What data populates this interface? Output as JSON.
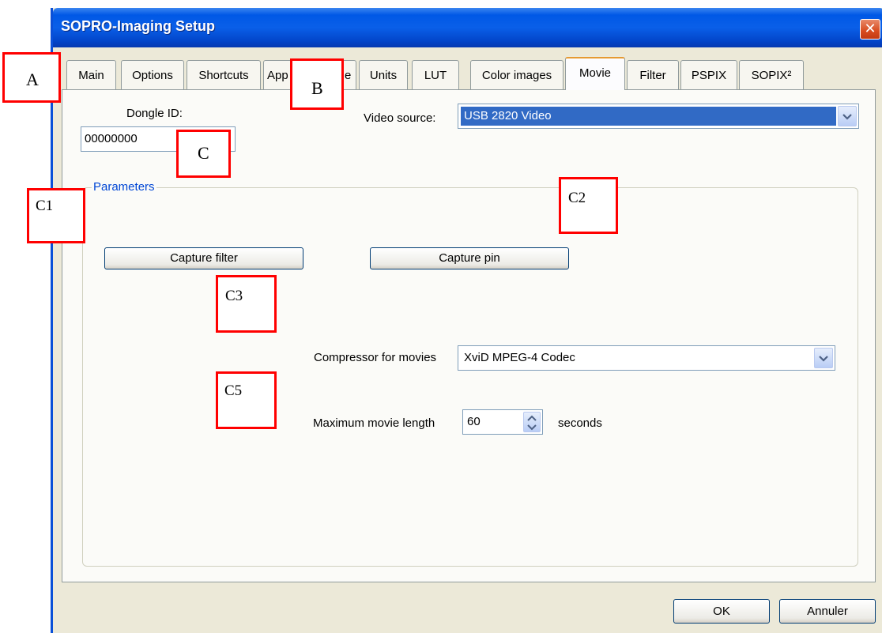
{
  "window": {
    "title": "SOPRO-Imaging Setup",
    "close_symbol": "✕"
  },
  "tabs": [
    {
      "label": "Main"
    },
    {
      "label": "Options"
    },
    {
      "label": "Shortcuts"
    },
    {
      "label": "App"
    },
    {
      "label": "e"
    },
    {
      "label": "Units"
    },
    {
      "label": "LUT"
    },
    {
      "label": "Color images"
    },
    {
      "label": "Movie",
      "active": true
    },
    {
      "label": "Filter"
    },
    {
      "label": "PSPIX"
    },
    {
      "label": "SOPIX²"
    }
  ],
  "dongle": {
    "label": "Dongle ID:",
    "value": "00000000"
  },
  "video_source": {
    "label": "Video source:",
    "value": "USB 2820 Video"
  },
  "parameters": {
    "title": "Parameters",
    "capture_filter_label": "Capture filter",
    "capture_pin_label": "Capture pin",
    "compressor_label": "Compressor for movies",
    "compressor_value": "XviD MPEG-4 Codec",
    "max_length_label": "Maximum movie length",
    "max_length_value": "60",
    "max_length_unit": "seconds"
  },
  "footer": {
    "ok_label": "OK",
    "cancel_label": "Annuler"
  },
  "annotations": {
    "a": "A",
    "b": "B",
    "c": "C",
    "c1": "C1",
    "c2": "C2",
    "c3": "C3",
    "c5": "C5"
  },
  "colors": {
    "titlebar": "#0058e6",
    "annotation_border": "#ff0000",
    "active_tab_accent": "#e69a32",
    "selection": "#316ac5",
    "group_title": "#0046d5"
  }
}
